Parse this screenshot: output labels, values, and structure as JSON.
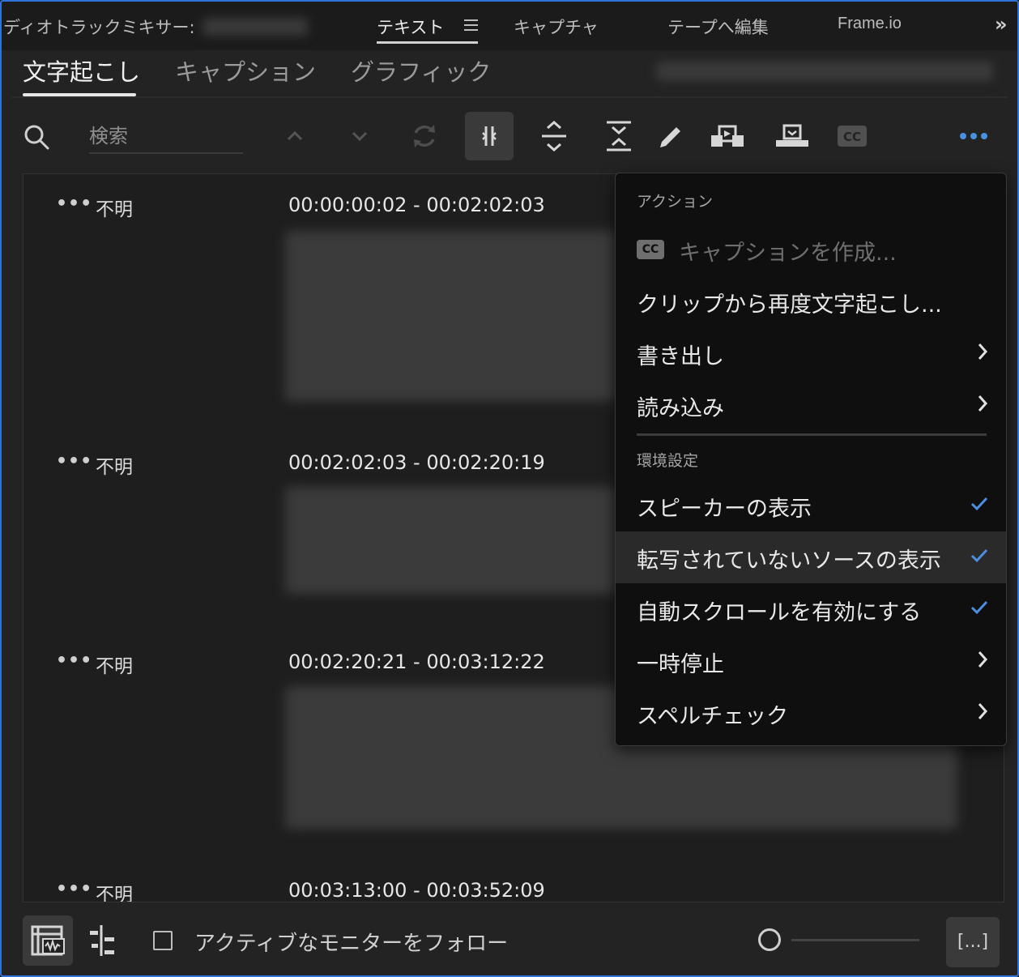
{
  "panel_tabs": {
    "audio_mixer_prefix": "ディオトラックミキサー:",
    "text": "テキスト",
    "capture": "キャプチャ",
    "edit_to_tape": "テープへ編集",
    "frameio": "Frame.io",
    "overflow": "»"
  },
  "sub_tabs": {
    "transcript": "文字起こし",
    "captions": "キャプション",
    "graphics": "グラフィック"
  },
  "search": {
    "placeholder": "検索"
  },
  "toolbar": {
    "icons": [
      "search-icon",
      "chevron-up-icon",
      "chevron-down-icon",
      "refresh-icon",
      "split-segment-icon",
      "merge-expand-icon",
      "merge-collapse-icon",
      "pencil-icon",
      "insert-icon",
      "overwrite-icon",
      "cc-icon",
      "more-icon"
    ],
    "accent": "#4a90e2"
  },
  "segments": [
    {
      "dots": "•••",
      "speaker": "不明",
      "timecode": "00:00:00:02 - 00:02:02:03"
    },
    {
      "dots": "•••",
      "speaker": "不明",
      "timecode": "00:02:02:03 - 00:02:20:19"
    },
    {
      "dots": "•••",
      "speaker": "不明",
      "timecode": "00:02:20:21 - 00:03:12:22"
    },
    {
      "dots": "•••",
      "speaker": "不明",
      "timecode": "00:03:13:00 - 00:03:52:09"
    }
  ],
  "menu": {
    "section_actions": "アクション",
    "cc_badge": "CC",
    "create_captions": "キャプションを作成...",
    "retranscribe": "クリップから再度文字起こし...",
    "export": "書き出し",
    "import": "読み込み",
    "section_prefs": "環境設定",
    "show_speakers": "スピーカーの表示",
    "show_untranscribed": "転写されていないソースの表示",
    "auto_scroll": "自動スクロールを有効にする",
    "pause": "一時停止",
    "spellcheck": "スペルチェック",
    "check_color": "#4a8fe0"
  },
  "bottom": {
    "follow_monitor": "アクティブなモニターをフォロー",
    "bracket_button": "[...]"
  }
}
